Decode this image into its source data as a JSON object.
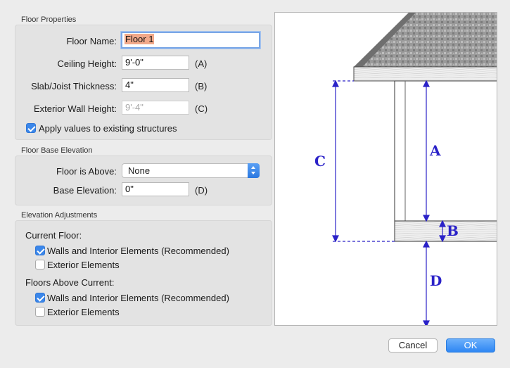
{
  "floor_properties": {
    "title": "Floor Properties",
    "floor_name_label": "Floor Name:",
    "floor_name_value": "Floor 1",
    "ceiling_height_label": "Ceiling Height:",
    "ceiling_height_value": "9'-0\"",
    "ceiling_height_suffix": "(A)",
    "slab_label": "Slab/Joist Thickness:",
    "slab_value": "4\"",
    "slab_suffix": "(B)",
    "ext_wall_label": "Exterior Wall Height:",
    "ext_wall_value": "9'-4\"",
    "ext_wall_suffix": "(C)",
    "apply_label": "Apply values to existing structures",
    "apply_checked": true
  },
  "floor_base_elevation": {
    "title": "Floor Base Elevation",
    "floor_above_label": "Floor is Above:",
    "floor_above_value": "None",
    "base_elevation_label": "Base Elevation:",
    "base_elevation_value": "0\"",
    "base_elevation_suffix": "(D)"
  },
  "elevation_adjustments": {
    "title": "Elevation Adjustments",
    "current_floor_label": "Current Floor:",
    "current_walls_label": "Walls and Interior Elements (Recommended)",
    "current_walls_checked": true,
    "current_exterior_label": "Exterior Elements",
    "current_exterior_checked": false,
    "above_label": "Floors Above Current:",
    "above_walls_label": "Walls and Interior Elements (Recommended)",
    "above_walls_checked": true,
    "above_exterior_label": "Exterior Elements",
    "above_exterior_checked": false
  },
  "diagram": {
    "label_a": "A",
    "label_b": "B",
    "label_c": "C",
    "label_d": "D",
    "accent_color": "#2b22c8"
  },
  "buttons": {
    "cancel": "Cancel",
    "ok": "OK"
  }
}
